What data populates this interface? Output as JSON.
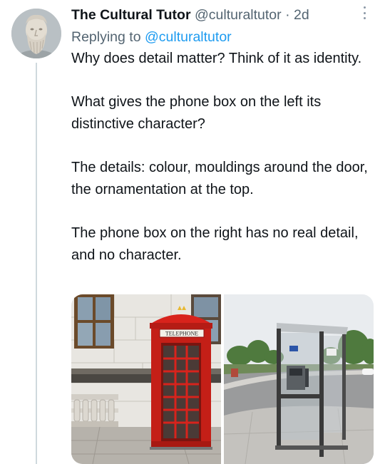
{
  "tweet": {
    "author_name": "The Cultural Tutor",
    "author_handle": "@culturaltutor",
    "separator": "·",
    "timestamp": "2d",
    "reply_prefix": "Replying to",
    "reply_handle": "@culturaltutor",
    "paragraphs": [
      "Why does detail matter? Think of it as identity.",
      "What gives the phone box on the left its distinctive character?",
      "The details: colour, mouldings around the door, the ornamentation at the top.",
      "The phone box on the right has no real detail, and no character."
    ],
    "media": {
      "left_sign": "TELEPHONE",
      "left_icon": "red-phone-box-photo",
      "right_icon": "modern-phone-box-photo"
    }
  },
  "icons": {
    "more": "more-dots-icon",
    "avatar": "bust-avatar"
  },
  "colors": {
    "link": "#1d9bf0",
    "secondary_text": "#536471",
    "thread_line": "#cfd9de",
    "phone_box_red": "#d8231c"
  }
}
